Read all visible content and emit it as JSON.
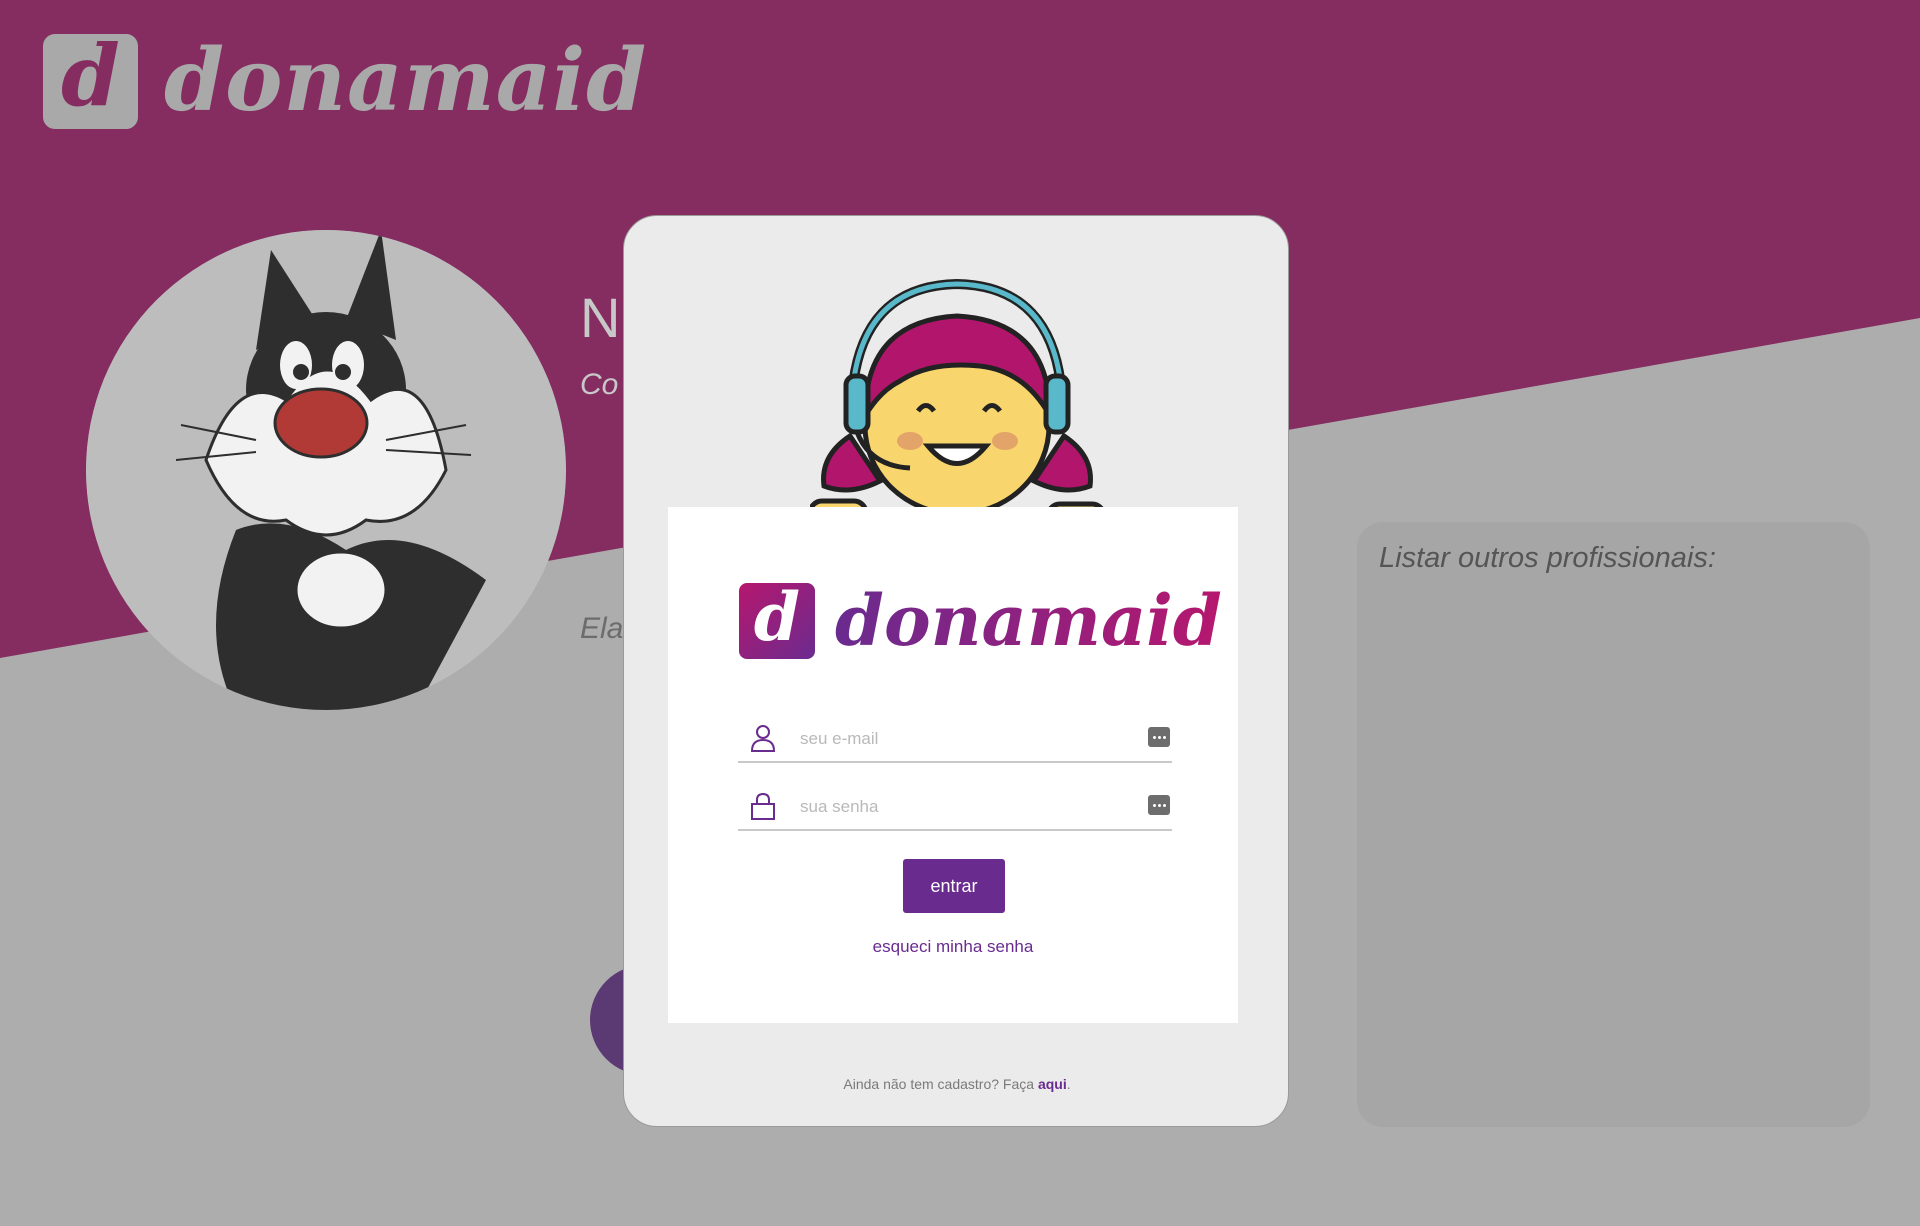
{
  "background": {
    "logo_mark": "d",
    "logo_text": "donamaid",
    "profile_name_partial": "N",
    "profile_subtitle_partial": "Co",
    "profile_desc_partial": "Ela",
    "side_panel_title": "Listar outros profissionais:"
  },
  "login": {
    "logo_mark": "d",
    "logo_text": "donamaid",
    "email_placeholder": "seu e-mail",
    "password_placeholder": "sua senha",
    "submit_label": "entrar",
    "forgot_label": "esqueci minha senha",
    "signup_text": "Ainda não tem cadastro? Faça ",
    "signup_link": "aqui",
    "signup_end": "."
  },
  "colors": {
    "brand_purple": "#6a2b8f",
    "brand_magenta": "#b6176e",
    "header_band": "#852c61",
    "overlay_gray": "#adadad"
  },
  "icons": [
    "user-icon",
    "lock-icon",
    "password-manager-icon",
    "headset-girl-mascot",
    "cat-avatar"
  ]
}
